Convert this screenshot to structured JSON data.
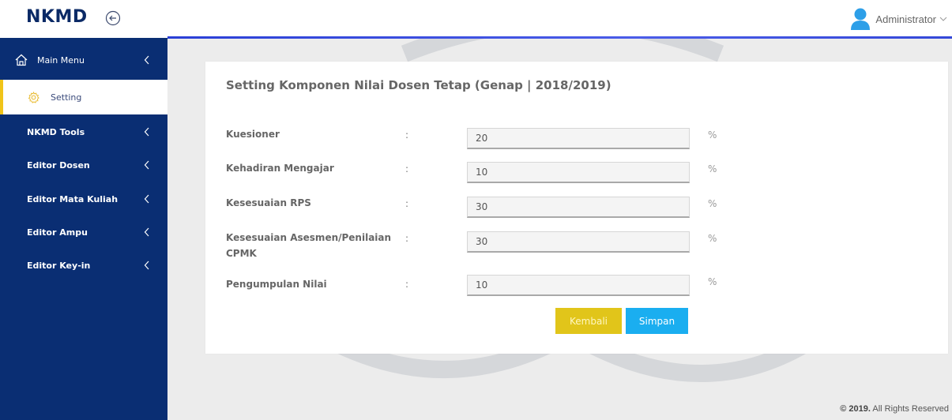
{
  "app": {
    "brand": "NKMD"
  },
  "user": {
    "name": "Administrator"
  },
  "sidebar": {
    "items": [
      {
        "label": "Main Menu"
      },
      {
        "label": "Setting"
      },
      {
        "label": "NKMD Tools"
      },
      {
        "label": "Editor Dosen"
      },
      {
        "label": "Editor Mata Kuliah"
      },
      {
        "label": "Editor Ampu"
      },
      {
        "label": "Editor Key-in"
      }
    ]
  },
  "form": {
    "title": "Setting Komponen Nilai Dosen Tetap (Genap | 2018/2019)",
    "colon": ":",
    "unit": "%",
    "rows": [
      {
        "label": "Kuesioner",
        "value": "20"
      },
      {
        "label": "Kehadiran Mengajar",
        "value": "10"
      },
      {
        "label": "Kesesuaian RPS",
        "value": "30"
      },
      {
        "label": "Kesesuaian Asesmen/Penilaian CPMK",
        "value": "30"
      },
      {
        "label": "Pengumpulan Nilai",
        "value": "10"
      }
    ],
    "back_label": "Kembali",
    "save_label": "Simpan"
  },
  "footer": {
    "year": "© 2019.",
    "text": " All Rights Reserved"
  },
  "colors": {
    "sidebar_bg": "#0a2e73",
    "active_accent": "#f0c419",
    "back_button": "#e1c51a",
    "save_button": "#1aaef0",
    "top_line": "#2a3fd6"
  },
  "icons": [
    "back-circle-icon",
    "user-avatar-icon",
    "chevron-down-icon",
    "home-icon",
    "gear-icon",
    "chevron-left-icon"
  ]
}
